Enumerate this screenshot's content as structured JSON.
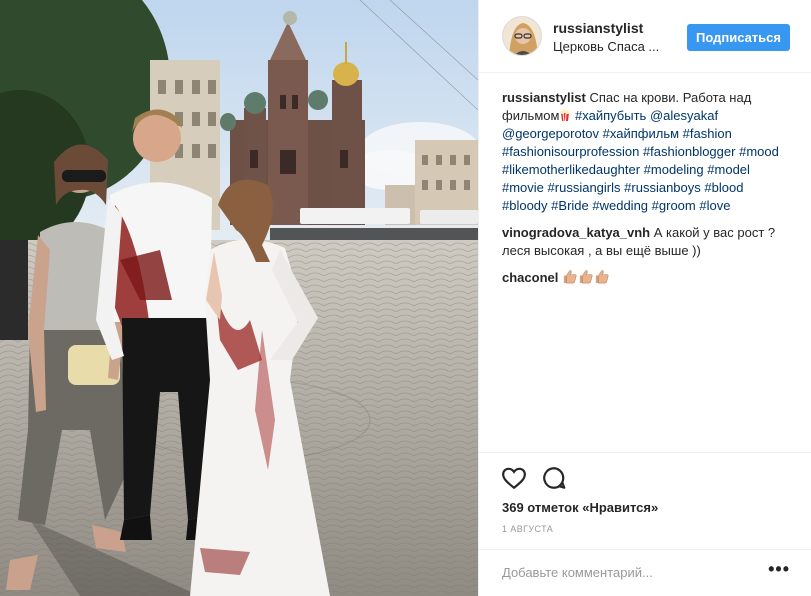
{
  "post": {
    "username": "russianstylist",
    "location": "Церковь Спаса ...",
    "follow_label": "Подписаться",
    "image_alt": "Фото пользователя russianstylist"
  },
  "caption": {
    "username": "russianstylist",
    "text_1": "Спас на крови. Работа над фильмом",
    "emoji": "popcorn",
    "hashtags_line": [
      "#хайпубыть",
      "@alesyakaf",
      "@georgeporotov",
      "#хайпфильм",
      "#fashion",
      "#fashionisourprofession",
      "#fashionblogger",
      "#mood",
      "#likemotherlikedaughter",
      "#modeling",
      "#model",
      "#movie",
      "#russiangirls",
      "#russianboys",
      "#blood",
      "#bloody",
      "#Bride",
      "#wedding",
      "#groom",
      "#love"
    ]
  },
  "comments": [
    {
      "username": "vinogradova_katya_vnh",
      "text": "А какой у вас рост ? леся высокая , а вы ещё выше ))"
    },
    {
      "username": "chaconel",
      "emoji": [
        "thumbs-up",
        "thumbs-up",
        "thumbs-up"
      ]
    }
  ],
  "actions": {
    "like_icon": "heart-icon",
    "comment_icon": "comment-icon",
    "likes_text": "369 отметок «Нравится»",
    "date": "1 АВГУСТА",
    "comment_placeholder": "Добавьте комментарий...",
    "more_icon": "ellipsis-icon"
  },
  "colors": {
    "accent": "#3897f0",
    "link": "#003569",
    "text": "#262626",
    "muted": "#999999"
  }
}
